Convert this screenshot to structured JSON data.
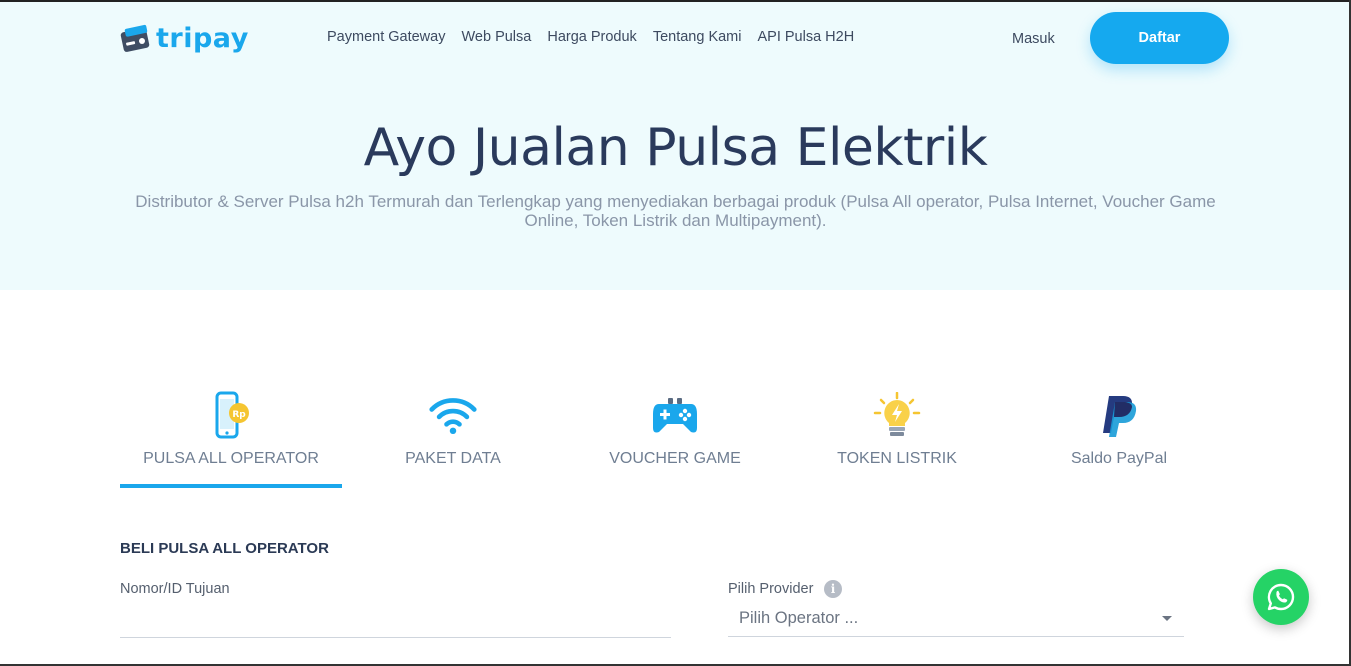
{
  "brand": {
    "name": "tripay",
    "logo_icon": "wallet-icon"
  },
  "nav": {
    "links": [
      "Payment Gateway",
      "Web Pulsa",
      "Harga Produk",
      "Tentang Kami",
      "API Pulsa H2H"
    ],
    "login_label": "Masuk",
    "register_label": "Daftar"
  },
  "hero": {
    "title": "Ayo Jualan Pulsa Elektrik",
    "subtitle": "Distributor & Server Pulsa h2h Termurah dan Terlengkap yang menyediakan berbagai produk (Pulsa All operator, Pulsa Internet, Voucher Game Online, Token Listrik dan Multipayment)."
  },
  "tabs": [
    {
      "label": "PULSA ALL OPERATOR",
      "icon": "phone-rupiah-icon",
      "active": true
    },
    {
      "label": "PAKET DATA",
      "icon": "wifi-icon",
      "active": false
    },
    {
      "label": "VOUCHER GAME",
      "icon": "gamepad-icon",
      "active": false
    },
    {
      "label": "TOKEN LISTRIK",
      "icon": "lightbulb-icon",
      "active": false
    },
    {
      "label": "Saldo PayPal",
      "icon": "paypal-icon",
      "active": false
    }
  ],
  "form": {
    "title": "BELI PULSA ALL OPERATOR",
    "target_label": "Nomor/ID Tujuan",
    "target_value": "",
    "provider_label": "Pilih Provider",
    "provider_value": "Pilih Operator ..."
  },
  "colors": {
    "accent": "#15a9ef",
    "hero_bg": "#eefbfd",
    "whatsapp": "#25d366"
  }
}
